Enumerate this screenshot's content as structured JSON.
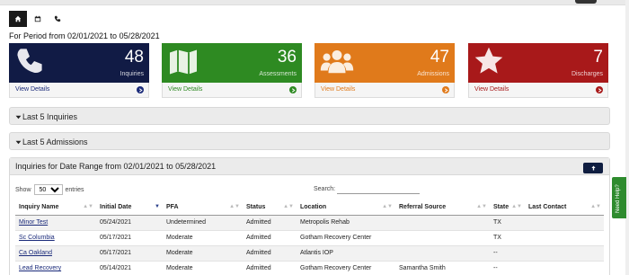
{
  "period": "For Period from 02/01/2021 to 05/28/2021",
  "tabs": [
    {
      "name": "home-tab",
      "icon": "home-icon",
      "active": true
    },
    {
      "name": "calendar-tab",
      "icon": "calendar-icon",
      "active": false
    },
    {
      "name": "phone-tab",
      "icon": "phone-icon",
      "active": false
    }
  ],
  "cards": [
    {
      "value": "48",
      "label": "Inquiries",
      "link": "View Details",
      "color": "#111b45",
      "link_color": "#1a2a7a",
      "icon": "phone-icon"
    },
    {
      "value": "36",
      "label": "Assessments",
      "link": "View Details",
      "color": "#2e8a22",
      "link_color": "#2e8a22",
      "icon": "map-icon"
    },
    {
      "value": "47",
      "label": "Admissions",
      "link": "View Details",
      "color": "#e07a1b",
      "link_color": "#e07a1b",
      "icon": "users-icon"
    },
    {
      "value": "7",
      "label": "Discharges",
      "link": "View Details",
      "color": "#a8191a",
      "link_color": "#a8191a",
      "icon": "star-icon"
    }
  ],
  "sections": {
    "last5_inquiries": "Last 5 Inquiries",
    "last5_admissions": "Last 5 Admissions"
  },
  "inquiries": {
    "title": "Inquiries for Date Range from 02/01/2021 to 05/28/2021",
    "show_label": "Show",
    "show_value": "50",
    "entries_label": "entries",
    "search_label": "Search:",
    "columns": [
      "Inquiry Name",
      "Initial Date",
      "PFA",
      "Status",
      "Location",
      "Referral Source",
      "State",
      "Last Contact"
    ],
    "rows": [
      [
        "Minor Test",
        "05/24/2021",
        "Undetermined",
        "Admitted",
        "Metropolis Rehab",
        "",
        "TX",
        ""
      ],
      [
        "Sc Columbia",
        "05/17/2021",
        "Moderate",
        "Admitted",
        "Gotham Recovery Center",
        "",
        "TX",
        ""
      ],
      [
        "Ca Oakland",
        "05/17/2021",
        "Moderate",
        "Admitted",
        "Atlantis IOP",
        "",
        "--",
        ""
      ],
      [
        "Lead Recovery",
        "05/14/2021",
        "Moderate",
        "Admitted",
        "Gotham Recovery Center",
        "Samantha Smith",
        "--",
        ""
      ]
    ]
  },
  "help": "Need Help?"
}
